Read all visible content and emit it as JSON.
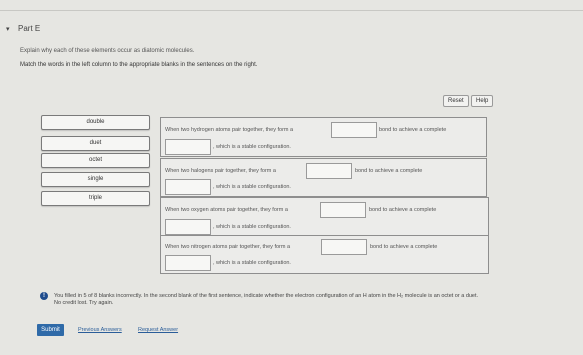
{
  "part": {
    "caret": "▾",
    "label": "Part E"
  },
  "prompt": "Explain why each of these elements occur as diatomic molecules.",
  "instruction": "Match the words in the left column to the appropriate blanks in the sentences on the right.",
  "toolbar": {
    "reset_label": "Reset",
    "help_label": "Help"
  },
  "words": [
    "double",
    "duet",
    "octet",
    "single",
    "triple"
  ],
  "sentences": [
    {
      "part1": "When two hydrogen atoms pair together, they form a",
      "part2": "bond to achieve a complete",
      "part3": ", which is a stable configuration."
    },
    {
      "part1": "When two halogens pair together, they form a",
      "part2": "bond to achieve a complete",
      "part3": ", which is a stable configuration."
    },
    {
      "part1": "When two oxygen atoms pair together, they form a",
      "part2": "bond to achieve a complete",
      "part3": ", which is a stable configuration."
    },
    {
      "part1": "When two nitrogen atoms pair together, they form a",
      "part2": "bond to achieve a complete",
      "part3": ", which is a stable configuration."
    }
  ],
  "feedback": {
    "icon": "!",
    "line1": "You filled in 5 of 8 blanks incorrectly. In the second blank of the first sentence, indicate whether the electron configuration of an H atom in the H₂ molecule is an octet or a duet.",
    "line2": "No credit lost. Try again."
  },
  "footer": {
    "submit_label": "Submit",
    "previous_answers": "Previous Answers",
    "request_answer": "Request Answer"
  }
}
